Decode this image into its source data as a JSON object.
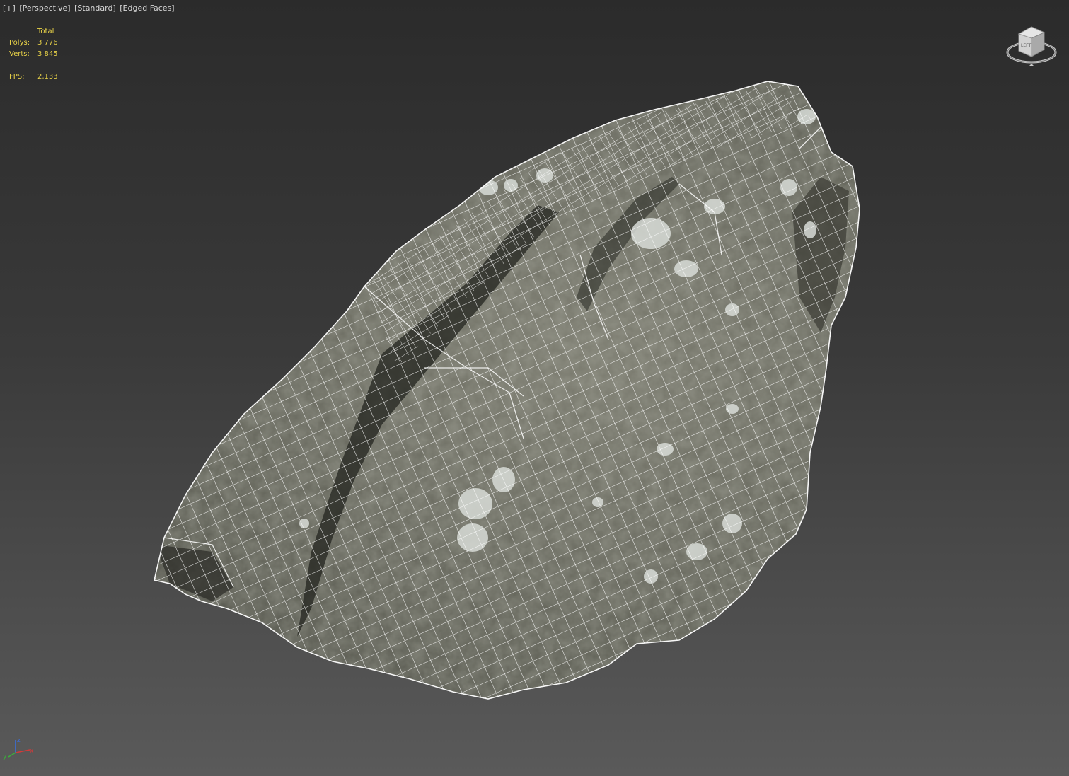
{
  "viewport": {
    "labels": [
      {
        "text": "[+]",
        "name": "viewport-menu-plus"
      },
      {
        "text": "[Perspective]",
        "name": "viewport-menu-perspective"
      },
      {
        "text": "[Standard]",
        "name": "viewport-menu-standard"
      },
      {
        "text": "[Edged Faces]",
        "name": "viewport-menu-shading"
      }
    ]
  },
  "stats": {
    "header": "Total",
    "polys_label": "Polys:",
    "polys_value": "3 776",
    "verts_label": "Verts:",
    "verts_value": "3 845",
    "fps_label": "FPS:",
    "fps_value": "2,133"
  },
  "viewcube": {
    "face_label": "LEFT",
    "icon": "viewcube-icon"
  },
  "axis_tripod": {
    "x_label": "x",
    "y_label": "y",
    "z_label": "z",
    "icon": "axis-tripod-icon"
  },
  "colors": {
    "stats_text": "#e8d248",
    "label_text": "#d8d8d8",
    "wireframe": "#ffffff",
    "rock_base": "#6b6b5f",
    "background_top": "#2b2b2b",
    "background_bottom": "#5a5a5a"
  }
}
